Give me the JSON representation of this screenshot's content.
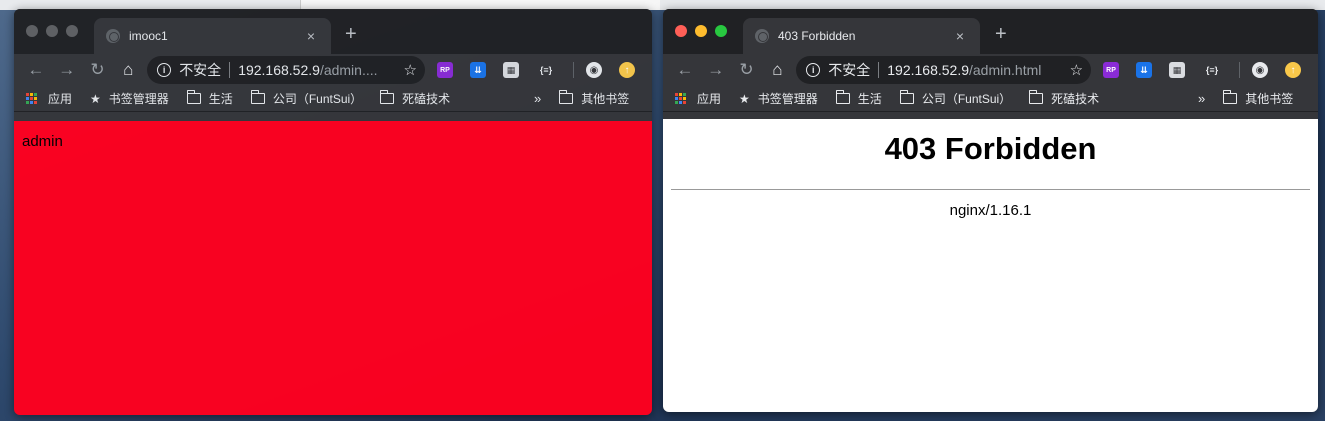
{
  "left_window": {
    "tab_title": "imooc1",
    "tab_close": "×",
    "new_tab": "+",
    "insecure_label": "不安全",
    "url_host": "192.168.52.9",
    "url_path": "/admin....",
    "page_text": "admin",
    "page_bg_color": "#ff001f"
  },
  "right_window": {
    "tab_title": "403 Forbidden",
    "tab_close": "×",
    "new_tab": "+",
    "insecure_label": "不安全",
    "url_host": "192.168.52.9",
    "url_path": "/admin.html",
    "heading": "403 Forbidden",
    "server": "nginx/1.16.1"
  },
  "toolbar": {
    "back": "←",
    "forward": "→",
    "reload": "↻",
    "home": "⌂",
    "info": "i",
    "star": "☆"
  },
  "extensions": {
    "rp": "RP",
    "pocket": "⇊",
    "grid": "▦",
    "json": "{≡}",
    "avatar": "◉",
    "update": "↑"
  },
  "bookmarks": {
    "apps": "应用",
    "manager": "书签管理器",
    "life": "生活",
    "company": "公司（FuntSui）",
    "tech": "死磕技术",
    "more": "»",
    "other": "其他书签"
  },
  "colors": {
    "tab_strip": "#202124",
    "toolbar": "#35363a",
    "traffic_red": "#ff5f57",
    "traffic_yellow": "#febc2e",
    "traffic_green": "#28c840"
  }
}
